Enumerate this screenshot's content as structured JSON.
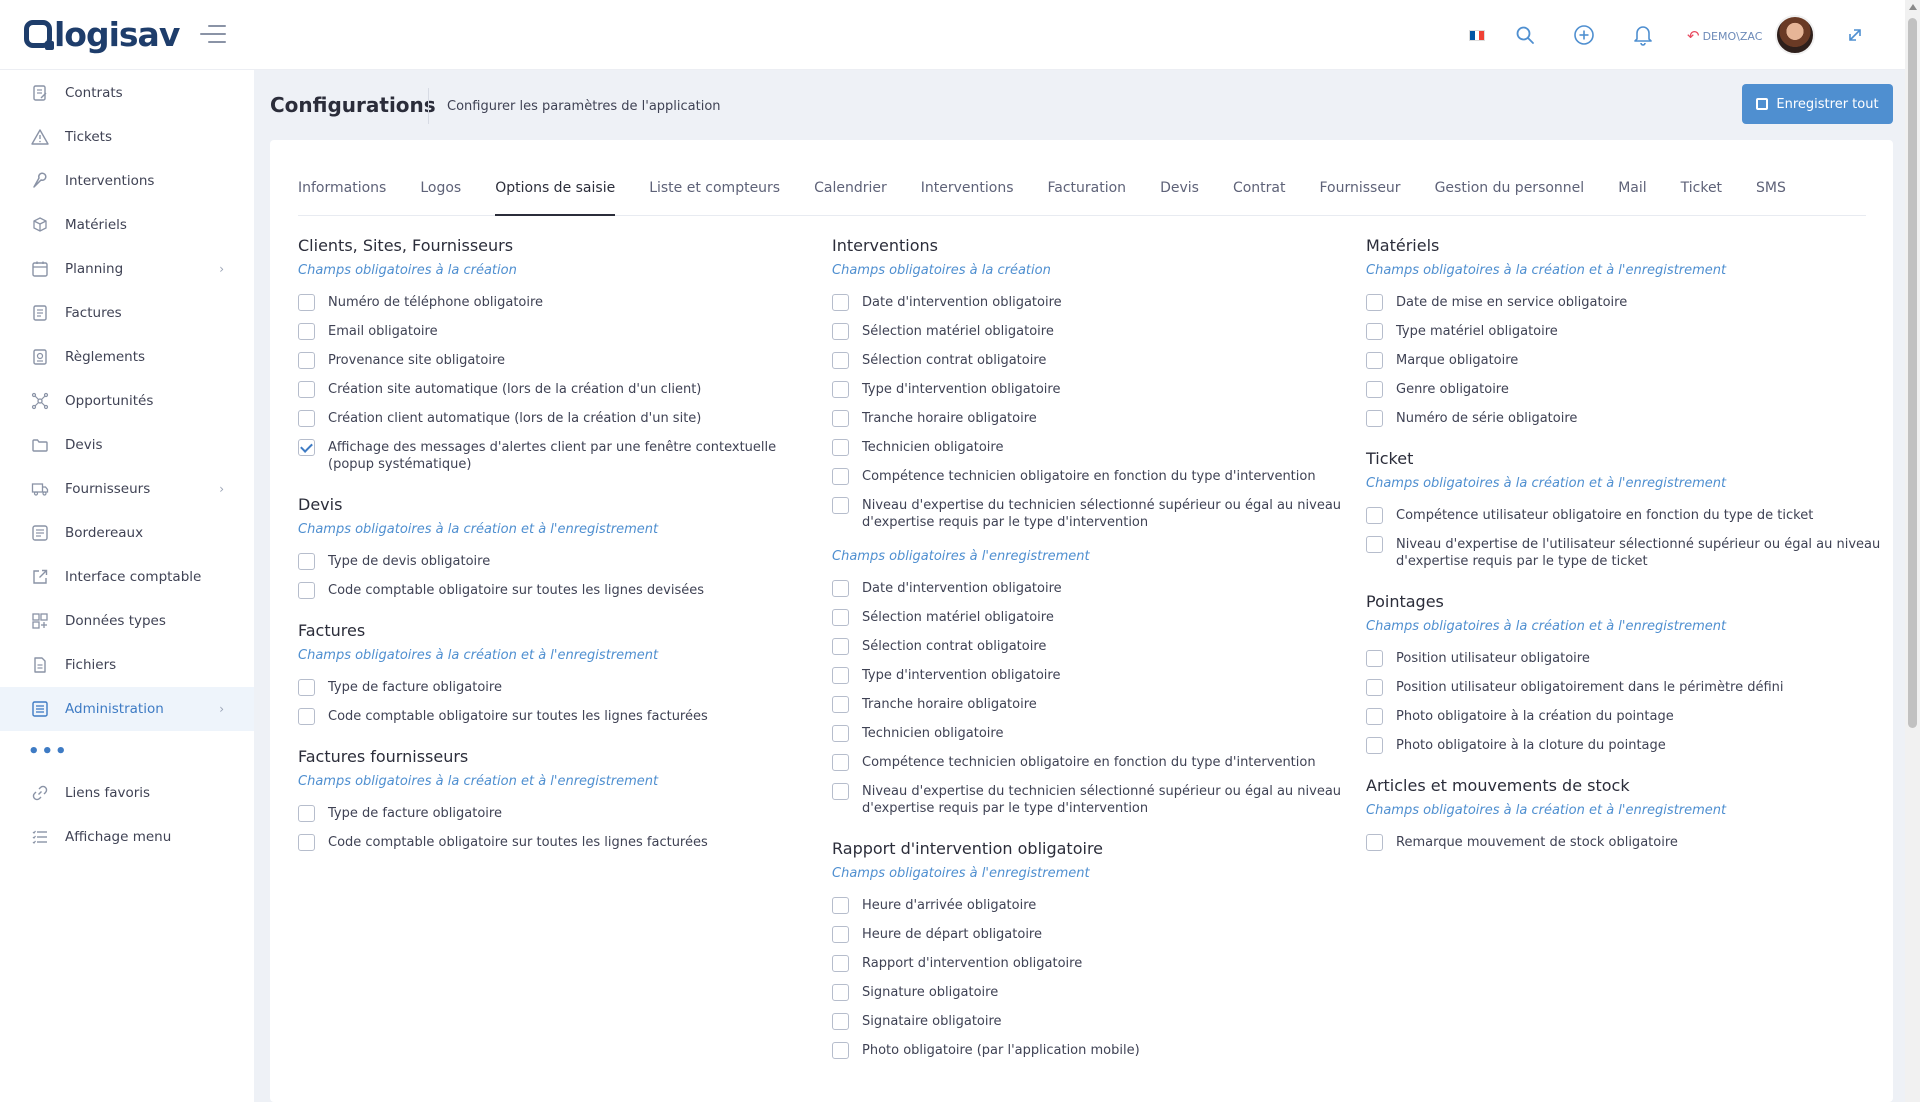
{
  "header": {
    "logo_text": "logisav",
    "user_label": "DEMO\\ZAC",
    "flag_colors": [
      "#0055a4",
      "#ffffff",
      "#ef4135"
    ],
    "icons": [
      "search-icon",
      "plus-circle-icon",
      "bell-icon",
      "expand-icon"
    ]
  },
  "sidebar": {
    "items": [
      {
        "label": "Contrats",
        "icon": "contract-icon",
        "chevron": false
      },
      {
        "label": "Tickets",
        "icon": "warning-icon",
        "chevron": false
      },
      {
        "label": "Interventions",
        "icon": "wrench-icon",
        "chevron": false
      },
      {
        "label": "Matériels",
        "icon": "box-icon",
        "chevron": false
      },
      {
        "label": "Planning",
        "icon": "calendar-icon",
        "chevron": true
      },
      {
        "label": "Factures",
        "icon": "invoice-icon",
        "chevron": false
      },
      {
        "label": "Règlements",
        "icon": "payment-icon",
        "chevron": false
      },
      {
        "label": "Opportunités",
        "icon": "network-icon",
        "chevron": false
      },
      {
        "label": "Devis",
        "icon": "folder-icon",
        "chevron": false
      },
      {
        "label": "Fournisseurs",
        "icon": "truck-icon",
        "chevron": true
      },
      {
        "label": "Bordereaux",
        "icon": "list-icon",
        "chevron": false
      },
      {
        "label": "Interface comptable",
        "icon": "external-link-icon",
        "chevron": false
      },
      {
        "label": "Données types",
        "icon": "grid-icon",
        "chevron": false
      },
      {
        "label": "Fichiers",
        "icon": "file-icon",
        "chevron": false
      },
      {
        "label": "Administration",
        "icon": "admin-icon",
        "chevron": true,
        "active": true
      }
    ],
    "dots": "•••",
    "bottom_items": [
      {
        "label": "Liens favoris",
        "icon": "link-icon"
      },
      {
        "label": "Affichage menu",
        "icon": "menu-list-icon"
      }
    ]
  },
  "page": {
    "title": "Configurations",
    "subtitle": "Configurer les paramètres de l'application",
    "save_label": "Enregistrer tout",
    "accent": "#4f8fd0"
  },
  "tabs": [
    {
      "label": "Informations"
    },
    {
      "label": "Logos"
    },
    {
      "label": "Options de saisie",
      "active": true
    },
    {
      "label": "Liste et compteurs"
    },
    {
      "label": "Calendrier"
    },
    {
      "label": "Interventions"
    },
    {
      "label": "Facturation"
    },
    {
      "label": "Devis"
    },
    {
      "label": "Contrat"
    },
    {
      "label": "Fournisseur"
    },
    {
      "label": "Gestion du personnel"
    },
    {
      "label": "Mail"
    },
    {
      "label": "Ticket"
    },
    {
      "label": "SMS"
    }
  ],
  "columns": [
    {
      "sections": [
        {
          "title": "Clients, Sites, Fournisseurs",
          "groups": [
            {
              "subtitle": "Champs obligatoires à la création",
              "items": [
                {
                  "label": "Numéro de téléphone obligatoire",
                  "checked": false
                },
                {
                  "label": "Email obligatoire",
                  "checked": false
                },
                {
                  "label": "Provenance site obligatoire",
                  "checked": false
                },
                {
                  "label": "Création site automatique (lors de la création d'un client)",
                  "checked": false
                },
                {
                  "label": "Création client automatique (lors de la création d'un site)",
                  "checked": false
                },
                {
                  "label": "Affichage des messages d'alertes client par une fenêtre contextuelle (popup systématique)",
                  "checked": true
                }
              ]
            }
          ]
        },
        {
          "title": "Devis",
          "groups": [
            {
              "subtitle": "Champs obligatoires à la création et à l'enregistrement",
              "items": [
                {
                  "label": "Type de devis obligatoire",
                  "checked": false
                },
                {
                  "label": "Code comptable obligatoire sur toutes les lignes devisées",
                  "checked": false
                }
              ]
            }
          ]
        },
        {
          "title": "Factures",
          "groups": [
            {
              "subtitle": "Champs obligatoires à la création et à l'enregistrement",
              "items": [
                {
                  "label": "Type de facture obligatoire",
                  "checked": false
                },
                {
                  "label": "Code comptable obligatoire sur toutes les lignes facturées",
                  "checked": false
                }
              ]
            }
          ]
        },
        {
          "title": "Factures fournisseurs",
          "groups": [
            {
              "subtitle": "Champs obligatoires à la création et à l'enregistrement",
              "items": [
                {
                  "label": "Type de facture obligatoire",
                  "checked": false
                },
                {
                  "label": "Code comptable obligatoire sur toutes les lignes facturées",
                  "checked": false
                }
              ]
            }
          ]
        }
      ]
    },
    {
      "sections": [
        {
          "title": "Interventions",
          "groups": [
            {
              "subtitle": "Champs obligatoires à la création",
              "items": [
                {
                  "label": "Date d'intervention obligatoire",
                  "checked": false
                },
                {
                  "label": "Sélection matériel obligatoire",
                  "checked": false
                },
                {
                  "label": "Sélection contrat obligatoire",
                  "checked": false
                },
                {
                  "label": "Type d'intervention obligatoire",
                  "checked": false
                },
                {
                  "label": "Tranche horaire obligatoire",
                  "checked": false
                },
                {
                  "label": "Technicien obligatoire",
                  "checked": false
                },
                {
                  "label": "Compétence technicien obligatoire en fonction du type d'intervention",
                  "checked": false
                },
                {
                  "label": "Niveau d'expertise du technicien sélectionné supérieur ou égal au niveau d'expertise requis par le type d'intervention",
                  "checked": false
                }
              ]
            },
            {
              "subtitle": "Champs obligatoires à l'enregistrement",
              "items": [
                {
                  "label": "Date d'intervention obligatoire",
                  "checked": false
                },
                {
                  "label": "Sélection matériel obligatoire",
                  "checked": false
                },
                {
                  "label": "Sélection contrat obligatoire",
                  "checked": false
                },
                {
                  "label": "Type d'intervention obligatoire",
                  "checked": false
                },
                {
                  "label": "Tranche horaire obligatoire",
                  "checked": false
                },
                {
                  "label": "Technicien obligatoire",
                  "checked": false
                },
                {
                  "label": "Compétence technicien obligatoire en fonction du type d'intervention",
                  "checked": false
                },
                {
                  "label": "Niveau d'expertise du technicien sélectionné supérieur ou égal au niveau d'expertise requis par le type d'intervention",
                  "checked": false
                }
              ]
            }
          ]
        },
        {
          "title": "Rapport d'intervention obligatoire",
          "groups": [
            {
              "subtitle": "Champs obligatoires à l'enregistrement",
              "items": [
                {
                  "label": "Heure d'arrivée obligatoire",
                  "checked": false
                },
                {
                  "label": "Heure de départ obligatoire",
                  "checked": false
                },
                {
                  "label": "Rapport d'intervention obligatoire",
                  "checked": false
                },
                {
                  "label": "Signature obligatoire",
                  "checked": false
                },
                {
                  "label": "Signataire obligatoire",
                  "checked": false
                },
                {
                  "label": "Photo obligatoire (par l'application mobile)",
                  "checked": false
                }
              ]
            }
          ]
        }
      ]
    },
    {
      "sections": [
        {
          "title": "Matériels",
          "groups": [
            {
              "subtitle": "Champs obligatoires à la création et à l'enregistrement",
              "items": [
                {
                  "label": "Date de mise en service obligatoire",
                  "checked": false
                },
                {
                  "label": "Type matériel obligatoire",
                  "checked": false
                },
                {
                  "label": "Marque obligatoire",
                  "checked": false
                },
                {
                  "label": "Genre obligatoire",
                  "checked": false
                },
                {
                  "label": "Numéro de série obligatoire",
                  "checked": false
                }
              ]
            }
          ]
        },
        {
          "title": "Ticket",
          "groups": [
            {
              "subtitle": "Champs obligatoires à la création et à l'enregistrement",
              "items": [
                {
                  "label": "Compétence utilisateur obligatoire en fonction du type de ticket",
                  "checked": false
                },
                {
                  "label": "Niveau d'expertise de l'utilisateur sélectionné supérieur ou égal au niveau d'expertise requis par le type de ticket",
                  "checked": false
                }
              ]
            }
          ]
        },
        {
          "title": "Pointages",
          "groups": [
            {
              "subtitle": "Champs obligatoires à la création et à l'enregistrement",
              "items": [
                {
                  "label": "Position utilisateur obligatoire",
                  "checked": false
                },
                {
                  "label": "Position utilisateur obligatoirement dans le périmètre défini",
                  "checked": false
                },
                {
                  "label": "Photo obligatoire à la création du pointage",
                  "checked": false
                },
                {
                  "label": "Photo obligatoire à la cloture du pointage",
                  "checked": false
                }
              ]
            }
          ]
        },
        {
          "title": "Articles et mouvements de stock",
          "groups": [
            {
              "subtitle": "Champs obligatoires à la création et à l'enregistrement",
              "items": [
                {
                  "label": "Remarque mouvement de stock obligatoire",
                  "checked": false
                }
              ]
            }
          ]
        }
      ]
    }
  ]
}
